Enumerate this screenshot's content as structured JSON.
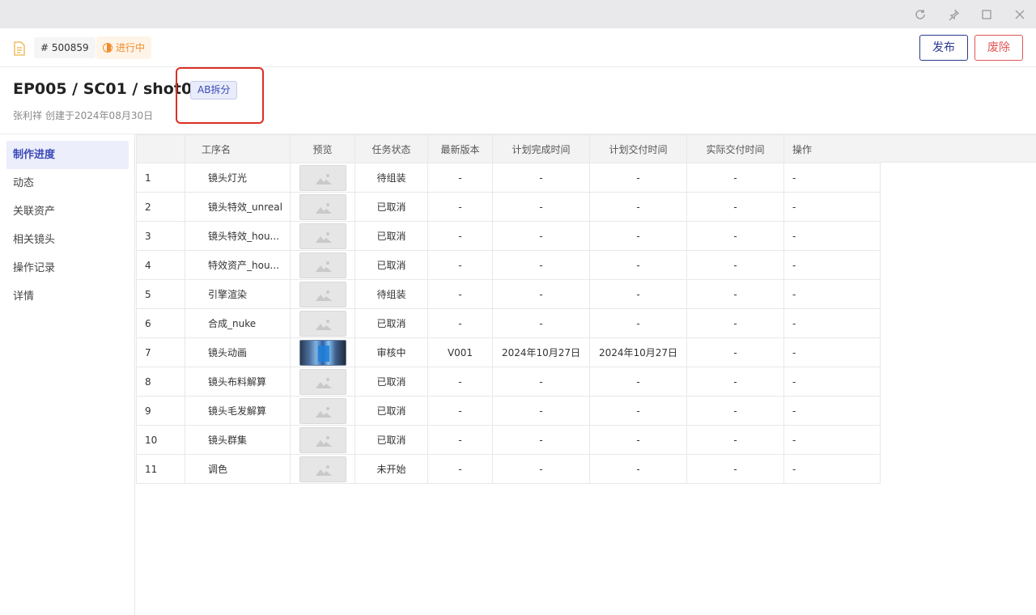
{
  "window": {
    "controls": [
      "refresh-icon",
      "pin-icon",
      "maximize-icon",
      "close-icon"
    ]
  },
  "header": {
    "id_tag": "# 500859",
    "status": "进行中",
    "publish_label": "发布",
    "abolish_label": "废除"
  },
  "title": {
    "text": "EP005 / SC01 / shot003",
    "tag": "AB拆分",
    "author": "张利祥",
    "created": "创建于2024年08月30日"
  },
  "sidebar": {
    "items": [
      {
        "label": "制作进度",
        "active": true
      },
      {
        "label": "动态"
      },
      {
        "label": "关联资产"
      },
      {
        "label": "相关镜头"
      },
      {
        "label": "操作记录"
      },
      {
        "label": "详情"
      }
    ]
  },
  "table": {
    "headers": [
      "",
      "工序名",
      "预览",
      "任务状态",
      "最新版本",
      "计划完成时间",
      "计划交付时间",
      "实际交付时间",
      "操作"
    ],
    "rows": [
      {
        "idx": "1",
        "name": "镜头灯光",
        "preview": "placeholder",
        "status": "待组装",
        "version": "-",
        "plan_done": "-",
        "plan_deliver": "-",
        "actual_deliver": "-",
        "op": "-"
      },
      {
        "idx": "2",
        "name": "镜头特效_unreal",
        "preview": "placeholder",
        "status": "已取消",
        "version": "-",
        "plan_done": "-",
        "plan_deliver": "-",
        "actual_deliver": "-",
        "op": "-"
      },
      {
        "idx": "3",
        "name": "镜头特效_hou...",
        "preview": "placeholder",
        "status": "已取消",
        "version": "-",
        "plan_done": "-",
        "plan_deliver": "-",
        "actual_deliver": "-",
        "op": "-"
      },
      {
        "idx": "4",
        "name": "特效资产_hou...",
        "preview": "placeholder",
        "status": "已取消",
        "version": "-",
        "plan_done": "-",
        "plan_deliver": "-",
        "actual_deliver": "-",
        "op": "-"
      },
      {
        "idx": "5",
        "name": "引擎渲染",
        "preview": "placeholder",
        "status": "待组装",
        "version": "-",
        "plan_done": "-",
        "plan_deliver": "-",
        "actual_deliver": "-",
        "op": "-"
      },
      {
        "idx": "6",
        "name": "合成_nuke",
        "preview": "placeholder",
        "status": "已取消",
        "version": "-",
        "plan_done": "-",
        "plan_deliver": "-",
        "actual_deliver": "-",
        "op": "-"
      },
      {
        "idx": "7",
        "name": "镜头动画",
        "preview": "image",
        "status": "审核中",
        "version": "V001",
        "plan_done": "2024年10月27日",
        "plan_deliver": "2024年10月27日",
        "actual_deliver": "-",
        "op": "-"
      },
      {
        "idx": "8",
        "name": "镜头布料解算",
        "preview": "placeholder",
        "status": "已取消",
        "version": "-",
        "plan_done": "-",
        "plan_deliver": "-",
        "actual_deliver": "-",
        "op": "-"
      },
      {
        "idx": "9",
        "name": "镜头毛发解算",
        "preview": "placeholder",
        "status": "已取消",
        "version": "-",
        "plan_done": "-",
        "plan_deliver": "-",
        "actual_deliver": "-",
        "op": "-"
      },
      {
        "idx": "10",
        "name": "镜头群集",
        "preview": "placeholder",
        "status": "已取消",
        "version": "-",
        "plan_done": "-",
        "plan_deliver": "-",
        "actual_deliver": "-",
        "op": "-"
      },
      {
        "idx": "11",
        "name": "调色",
        "preview": "placeholder",
        "status": "未开始",
        "version": "-",
        "plan_done": "-",
        "plan_deliver": "-",
        "actual_deliver": "-",
        "op": "-"
      }
    ]
  },
  "colors": {
    "accent": "#3a49b8",
    "publish": "#2b3a8f",
    "abolish": "#e05656",
    "in_progress": "#f08c2c",
    "highlight": "#d93025"
  }
}
